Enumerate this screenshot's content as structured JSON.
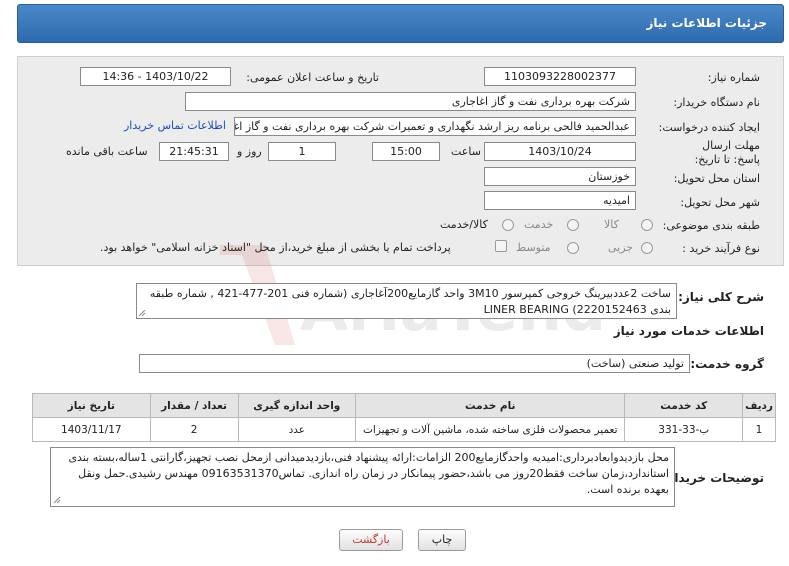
{
  "header": {
    "title": "جزئیات اطلاعات نیاز"
  },
  "fields": {
    "need_number_label": "شماره نیاز:",
    "need_number": "1103093228002377",
    "announce_label": "تاریخ و ساعت اعلان عمومی:",
    "announce_value": "1403/10/22 - 14:36",
    "buyer_org_label": "نام دستگاه خریدار:",
    "buyer_org": "شرکت بهره برداری نفت و گاز اغاجاری",
    "creator_label": "ایجاد کننده درخواست:",
    "creator": "عبدالحمید فالحی برنامه ریز ارشد نگهداری و تعمیرات شرکت بهره برداری نفت و گاز اغاجاری",
    "contact_link": "اطلاعات تماس خریدار",
    "deadline_label": "مهلت ارسال پاسخ: تا تاریخ:",
    "deadline_date": "1403/10/24",
    "time_label": "ساعت",
    "deadline_time": "15:00",
    "days_value": "1",
    "days_label": "روز و",
    "remaining_time": "21:45:31",
    "remaining_label": "ساعت باقی مانده",
    "province_label": "استان محل تحویل:",
    "province": "خوزستان",
    "city_label": "شهر محل تحویل:",
    "city": "امیدیه",
    "category_label": "طبقه بندی موضوعی:",
    "category_options": [
      "کالا",
      "خدمت",
      "کالا/خدمت"
    ],
    "process_label": "نوع فرآیند خرید :",
    "process_options": [
      "جزیی",
      "متوسط"
    ],
    "treasury_note": "پرداخت تمام یا بخشی از مبلغ خرید،از محل \"اسناد خزانه اسلامی\" خواهد بود."
  },
  "summary": {
    "label": "شرح کلی نیاز:",
    "text": "ساخت 2عددبیرینگ خروجی کمپرسور 3M10 واحد گازمایع200آغاجاری (شماره فنی 201-477-421 , شماره طبقه بندی 2220152463) LINER BEARING"
  },
  "services_section": {
    "title": "اطلاعات خدمات مورد نیاز",
    "group_label": "گروه خدمت:",
    "group_value": "تولید صنعتی (ساخت)"
  },
  "table": {
    "headers": [
      "ردیف",
      "کد خدمت",
      "نام خدمت",
      "واحد اندازه گیری",
      "تعداد / مقدار",
      "تاریخ نیاز"
    ],
    "rows": [
      [
        "1",
        "ب-33-331",
        "تعمیر محصولات فلزی ساخته شده، ماشین آلات و تجهیزات",
        "عدد",
        "2",
        "1403/11/17"
      ]
    ]
  },
  "buyer_notes": {
    "label": "توضیحات خریدار:",
    "text": "محل بازدیدوابعادبرداری:امیدیه واحدگازمایع200 الزامات:ارائه پیشنهاد فنی،بازدیدمیدانی ازمحل نصب تجهیز،گارانتی 1ساله،بسته بندی استاندارد،زمان ساخت فقط20روز می باشد،حضور پیمانکار در زمان راه اندازی. تماس09163531370 مهندس رشیدی.حمل ونقل بعهده برنده است."
  },
  "buttons": {
    "print": "چاپ",
    "back": "بازگشت"
  },
  "watermark": {
    "text": "AriaTender.net"
  },
  "colors": {
    "header": "#3a78bd",
    "link": "#1a4fb5",
    "back_text": "#c0392b"
  }
}
